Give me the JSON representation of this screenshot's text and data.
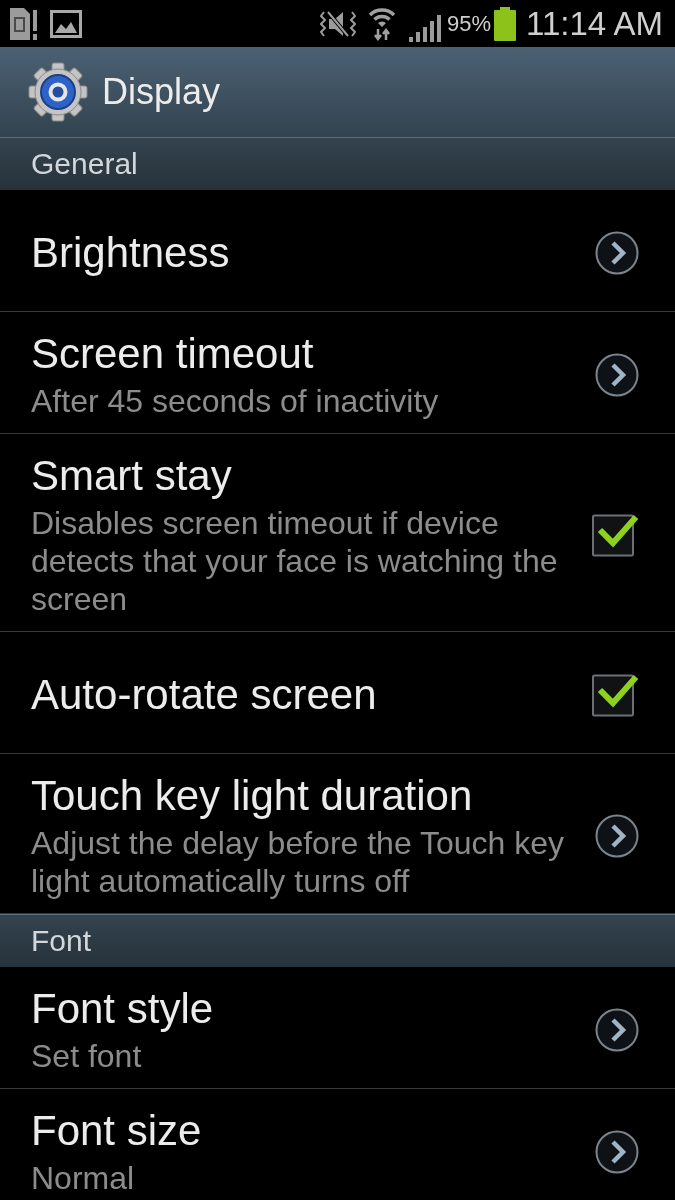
{
  "status_bar": {
    "battery_percent": "95%",
    "time": "11:14 AM"
  },
  "action_bar": {
    "title": "Display"
  },
  "sections": [
    {
      "header": "General",
      "items": [
        {
          "kind": "link",
          "title": "Brightness"
        },
        {
          "kind": "link",
          "title": "Screen timeout",
          "summary": "After 45 seconds of inactivity"
        },
        {
          "kind": "checkbox",
          "title": "Smart stay",
          "summary": "Disables screen timeout if device detects that your face is watching the screen",
          "checked": true
        },
        {
          "kind": "checkbox",
          "title": "Auto-rotate screen",
          "checked": true
        },
        {
          "kind": "link",
          "title": "Touch key light duration",
          "summary": "Adjust the delay before the Touch key light automatically turns off"
        }
      ]
    },
    {
      "header": "Font",
      "items": [
        {
          "kind": "link",
          "title": "Font style",
          "summary": "Set font"
        },
        {
          "kind": "link",
          "title": "Font size",
          "summary": "Normal"
        }
      ]
    }
  ]
}
